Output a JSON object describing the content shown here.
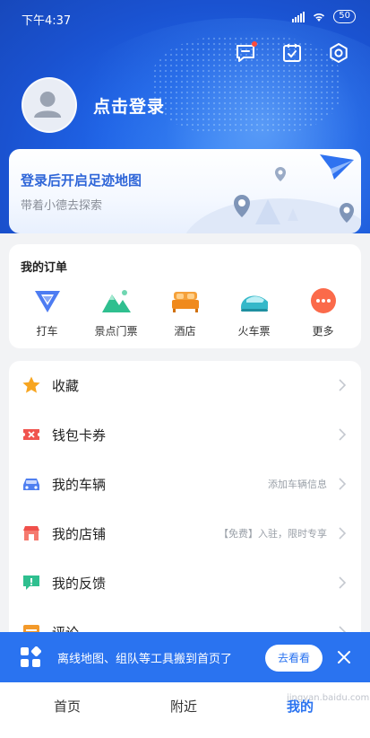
{
  "status_bar": {
    "time": "下午4:37",
    "battery": "50"
  },
  "header": {
    "login_label": "点击登录",
    "icons": [
      "message-icon",
      "checkin-icon",
      "settings-icon"
    ]
  },
  "footprint_card": {
    "title": "登录后开启足迹地图",
    "subtitle": "带着小德去探索"
  },
  "orders": {
    "title": "我的订单",
    "items": [
      {
        "label": "打车",
        "icon": "taxi-icon"
      },
      {
        "label": "景点门票",
        "icon": "scenic-ticket-icon"
      },
      {
        "label": "酒店",
        "icon": "hotel-icon"
      },
      {
        "label": "火车票",
        "icon": "train-ticket-icon"
      },
      {
        "label": "更多",
        "icon": "more-icon"
      }
    ]
  },
  "menu": [
    {
      "label": "收藏",
      "hint": "",
      "icon": "star-icon"
    },
    {
      "label": "钱包卡券",
      "hint": "",
      "icon": "coupon-icon"
    },
    {
      "label": "我的车辆",
      "hint": "添加车辆信息",
      "icon": "car-icon"
    },
    {
      "label": "我的店铺",
      "hint": "【免费】入驻，限时专享",
      "icon": "shop-icon"
    },
    {
      "label": "我的反馈",
      "hint": "",
      "icon": "feedback-icon"
    },
    {
      "label": "评论",
      "hint": "",
      "icon": "comment-icon"
    }
  ],
  "banner": {
    "text": "离线地图、组队等工具搬到首页了",
    "button": "去看看"
  },
  "tabs": [
    {
      "label": "首页",
      "active": false
    },
    {
      "label": "附近",
      "active": false
    },
    {
      "label": "我的",
      "active": true
    }
  ],
  "watermark": "jingyan.baidu.com",
  "colors": {
    "accent": "#2a73f0",
    "hero": "#1f63e6"
  }
}
